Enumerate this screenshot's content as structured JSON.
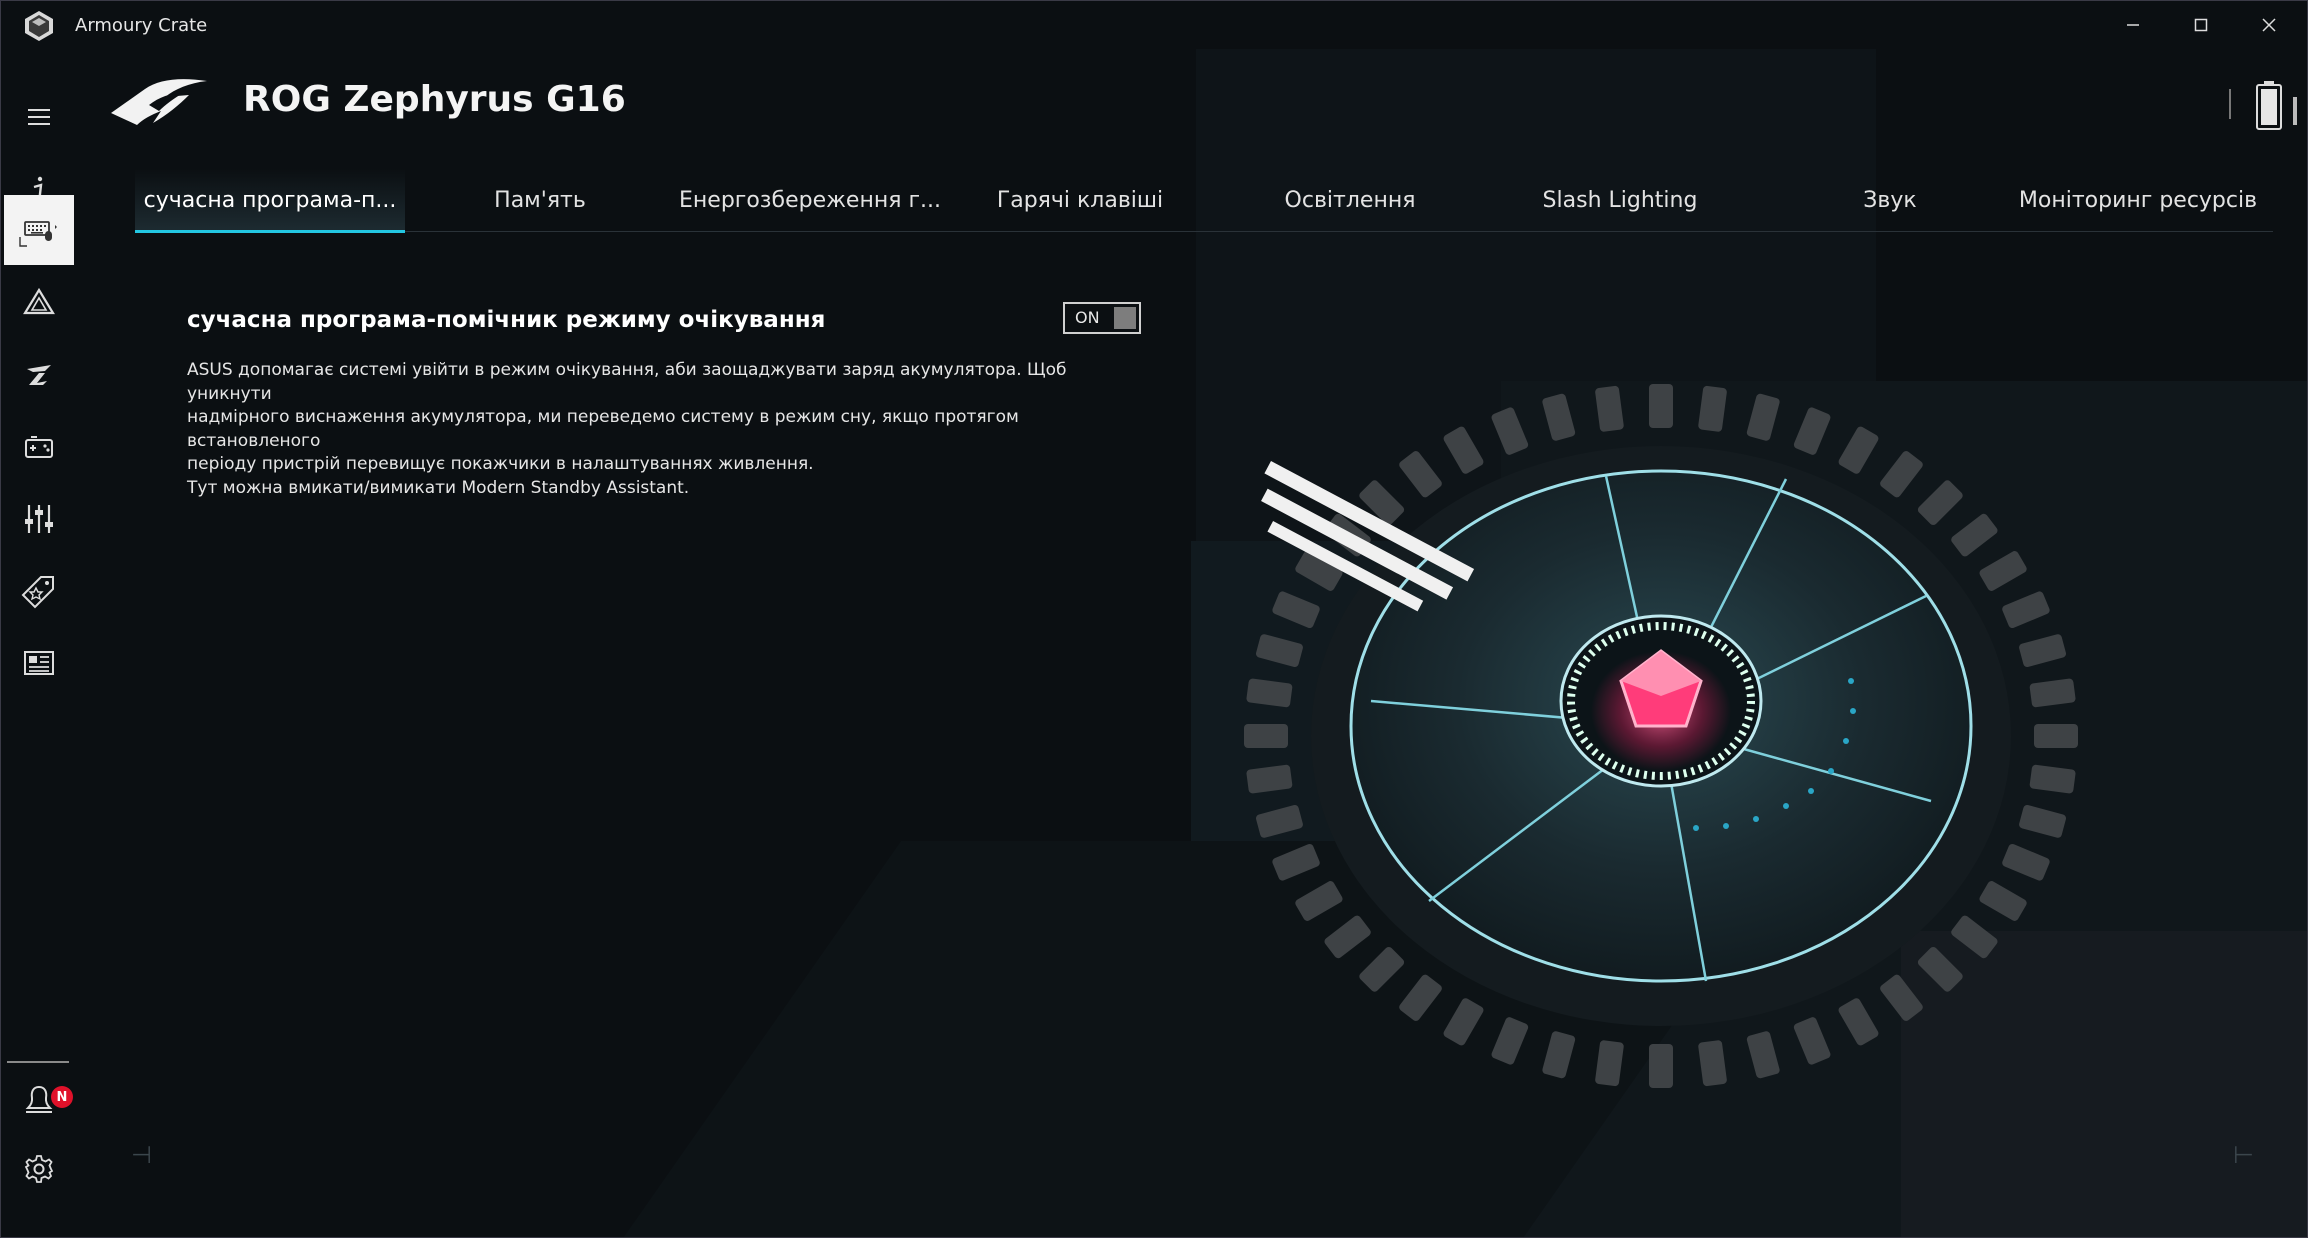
{
  "window": {
    "title": "Armoury Crate",
    "controls": {
      "minimize": "—",
      "maximize": "☐",
      "close": "✕"
    }
  },
  "sidebar": {
    "notification_badge": "N",
    "items": [
      {
        "name": "menu",
        "icon": "hamburger-icon"
      },
      {
        "name": "info",
        "icon": "info-icon"
      },
      {
        "name": "device",
        "icon": "keyboard-device-icon",
        "active": true
      },
      {
        "name": "aura",
        "icon": "aura-triangle-icon"
      },
      {
        "name": "armoury",
        "icon": "rog-armoury-icon"
      },
      {
        "name": "game-library",
        "icon": "gamepad-icon"
      },
      {
        "name": "tuning",
        "icon": "sliders-icon"
      },
      {
        "name": "deals",
        "icon": "tag-icon"
      },
      {
        "name": "news",
        "icon": "news-icon"
      },
      {
        "name": "user-center",
        "icon": "user-icon"
      },
      {
        "name": "settings",
        "icon": "gear-icon"
      }
    ]
  },
  "header": {
    "device_name": "ROG Zephyrus G16",
    "logo_icon": "rog-eye-logo"
  },
  "tabs": [
    {
      "label": "сучасна програма-п...",
      "active": true
    },
    {
      "label": "Пам'ять"
    },
    {
      "label": "Енергозбереження г..."
    },
    {
      "label": "Гарячі клавіші"
    },
    {
      "label": "Освітлення"
    },
    {
      "label": "Slash Lighting"
    },
    {
      "label": "Звук"
    },
    {
      "label": "Моніторинг ресурсів"
    }
  ],
  "content": {
    "title": "сучасна програма-помічник режиму очікування",
    "toggle": {
      "state": "ON"
    },
    "description": [
      "ASUS допомагає системі увійти в режим очікування, аби заощаджувати заряд акумулятора. Щоб уникнути",
      "надмірного виснаження акумулятора, ми переведемо систему в режим сну, якщо протягом встановленого",
      "періоду пристрій перевищує покажчики в налаштуваннях живлення.",
      "Тут можна вмикати/вимикати Modern Standby Assistant."
    ]
  },
  "colors": {
    "accent": "#23c7e2",
    "background": "#0b0f12",
    "badge": "#e0112a",
    "core": "#ff3c7a"
  }
}
